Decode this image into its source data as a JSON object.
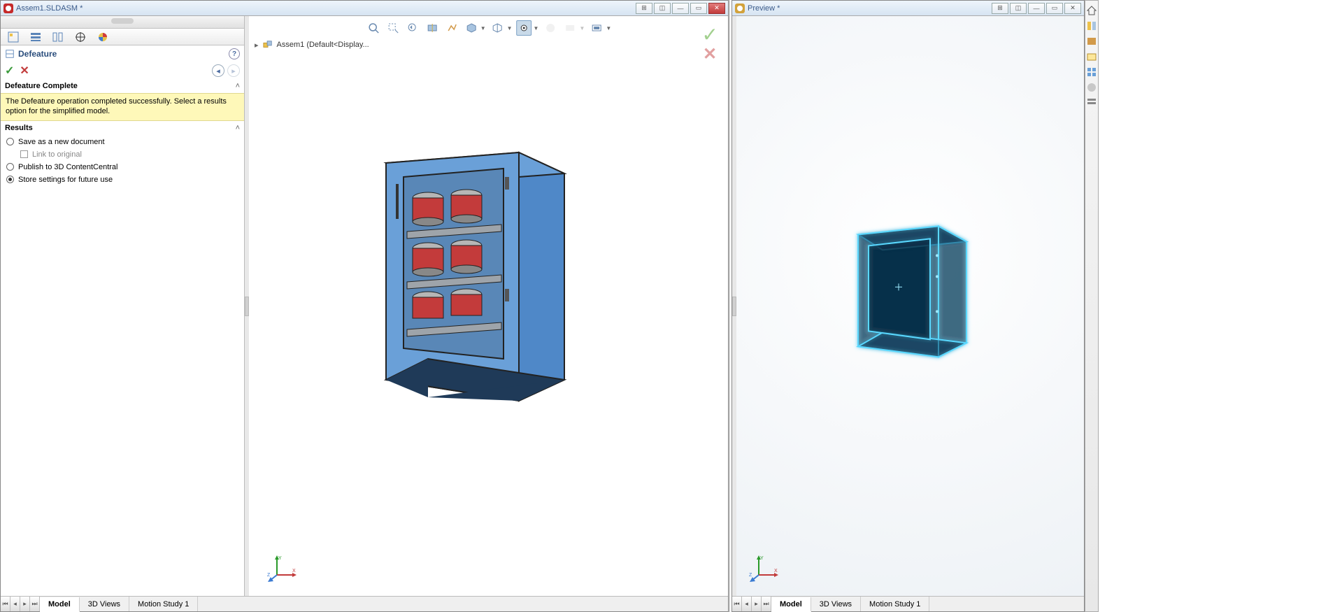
{
  "left_window": {
    "title": "Assem1.SLDASM *",
    "panel_name": "Defeature",
    "section_complete_title": "Defeature Complete",
    "complete_msg": "The Defeature operation completed successfully. Select a results option for the simplified model.",
    "results_title": "Results",
    "opt_save": "Save as a new document",
    "opt_link": "Link to original",
    "opt_publish": "Publish to 3D ContentCentral",
    "opt_store": "Store settings for future use",
    "breadcrumb": "Assem1  (Default<Display...",
    "bottom_tabs": {
      "model": "Model",
      "views3d": "3D Views",
      "motion": "Motion Study 1"
    }
  },
  "right_window": {
    "title": "Preview *",
    "bottom_tabs": {
      "model": "Model",
      "views3d": "3D Views",
      "motion": "Motion Study 1"
    }
  }
}
